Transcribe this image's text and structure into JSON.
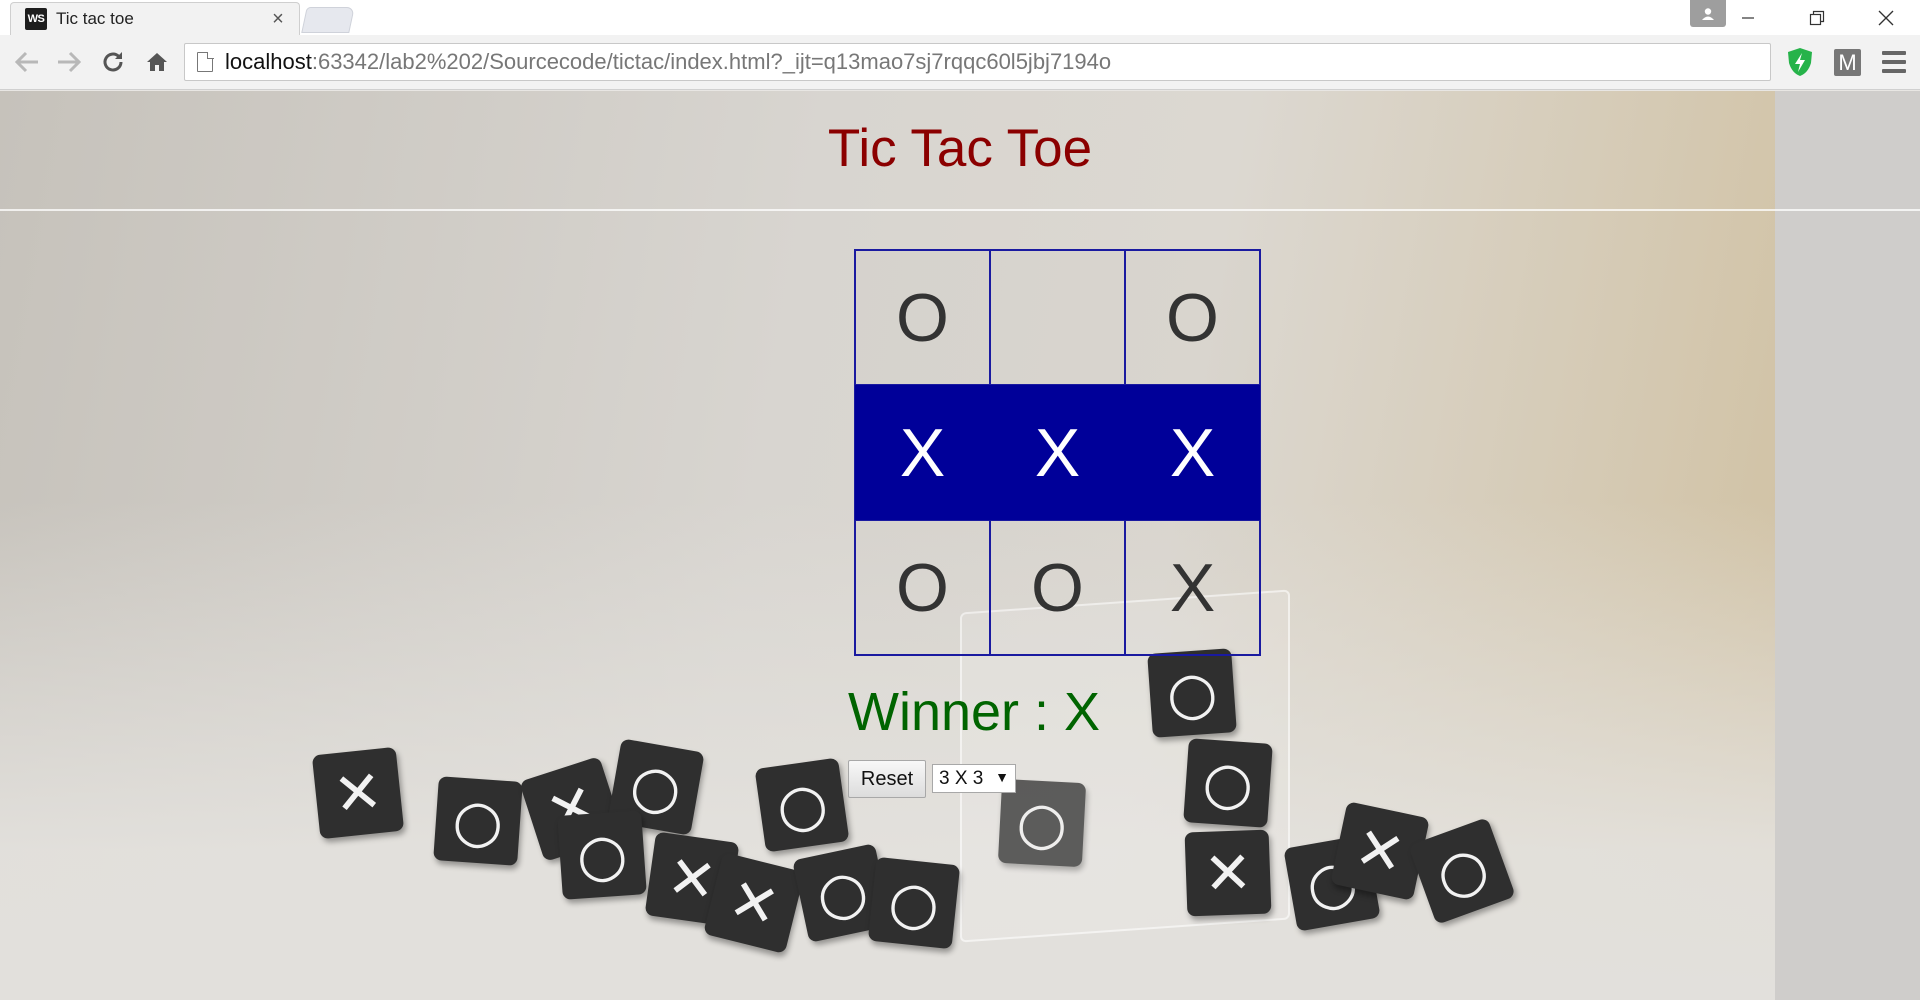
{
  "browser": {
    "tab_title": "Tic tac toe",
    "tab_favicon_text": "WS",
    "url_host": "localhost",
    "url_rest": ":63342/lab2%202/Sourcecode/tictac/index.html?_ijt=q13mao7sj7rqqc60l5jbj7194o",
    "extension_m_label": "M"
  },
  "page": {
    "title": "Tic Tac Toe",
    "winner_text": "Winner : X",
    "reset_label": "Reset",
    "grid_size_selected": "3 X 3"
  },
  "board": {
    "cells": [
      {
        "value": "O",
        "win": false
      },
      {
        "value": "",
        "win": false
      },
      {
        "value": "O",
        "win": false
      },
      {
        "value": "X",
        "win": true
      },
      {
        "value": "X",
        "win": true
      },
      {
        "value": "X",
        "win": true
      },
      {
        "value": "O",
        "win": false
      },
      {
        "value": "O",
        "win": false
      },
      {
        "value": "X",
        "win": false
      }
    ]
  },
  "colors": {
    "title": "#8b0000",
    "winner": "#006400",
    "win_highlight": "#000099",
    "grid_border": "#1a1aa0"
  },
  "icons": [
    "back-icon",
    "forward-icon",
    "reload-icon",
    "home-icon",
    "page-icon",
    "shield-icon",
    "menu-icon",
    "profile-icon",
    "minimize-icon",
    "restore-icon",
    "close-icon"
  ]
}
